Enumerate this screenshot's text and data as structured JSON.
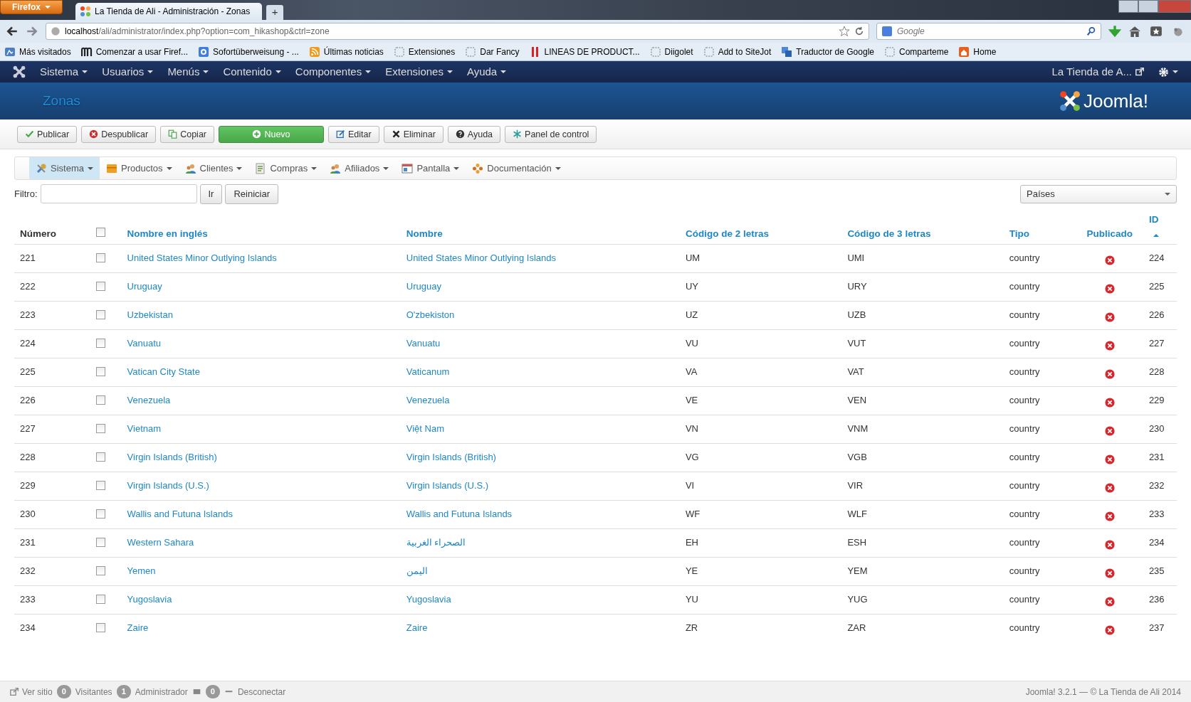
{
  "browser": {
    "app_button": "Firefox",
    "tab_title": "La Tienda de Ali - Administración - Zonas",
    "new_tab": "+",
    "url_host": "localhost",
    "url_path": "/ali/administrator/index.php?option=com_hikashop&ctrl=zone",
    "search_placeholder": "Google",
    "bookmarks": [
      "Más visitados",
      "Comenzar a usar Firef...",
      "Sofortüberweisung - ...",
      "Últimas noticias",
      "Extensiones",
      "Dar Fancy",
      "LINEAS DE PRODUCT...",
      "Diigolet",
      "Add to SiteJot",
      "Traductor de Google",
      "Comparteme",
      "Home"
    ]
  },
  "admin_menu": {
    "items": [
      "Sistema",
      "Usuarios",
      "Menús",
      "Contenido",
      "Componentes",
      "Extensiones",
      "Ayuda"
    ],
    "site_link": "La Tienda de A..."
  },
  "page_title": "Zonas",
  "logo_text": "Joomla!",
  "toolbar": [
    {
      "label": "Publicar",
      "kind": "default"
    },
    {
      "label": "Despublicar",
      "kind": "default"
    },
    {
      "label": "Copiar",
      "kind": "default"
    },
    {
      "label": "Nuevo",
      "kind": "success"
    },
    {
      "label": "Editar",
      "kind": "default"
    },
    {
      "label": "Eliminar",
      "kind": "default"
    },
    {
      "label": "Ayuda",
      "kind": "default"
    },
    {
      "label": "Panel de control",
      "kind": "default"
    }
  ],
  "submenu": [
    {
      "label": "Sistema",
      "selected": true
    },
    {
      "label": "Productos",
      "selected": false
    },
    {
      "label": "Clientes",
      "selected": false
    },
    {
      "label": "Compras",
      "selected": false
    },
    {
      "label": "Afiliados",
      "selected": false
    },
    {
      "label": "Pantalla",
      "selected": false
    },
    {
      "label": "Documentación",
      "selected": false
    }
  ],
  "filter": {
    "label": "Filtro:",
    "go": "Ir",
    "reset": "Reiniciar",
    "select_value": "Países"
  },
  "table": {
    "columns": [
      {
        "label": "Número",
        "kind": "text"
      },
      {
        "kind": "checkbox",
        "checked": false
      },
      {
        "label": "Nombre en inglés",
        "kind": "link"
      },
      {
        "label": "Nombre",
        "kind": "link"
      },
      {
        "label": "Código de 2 letras",
        "kind": "link"
      },
      {
        "label": "Código de 3 letras",
        "kind": "link"
      },
      {
        "label": "Tipo",
        "kind": "link"
      },
      {
        "label": "Publicado",
        "kind": "link"
      },
      {
        "label": "ID",
        "kind": "link",
        "sorted": true
      }
    ],
    "rows": [
      {
        "num": "221",
        "checked": false,
        "name_en": "United States Minor Outlying Islands",
        "name": "United States Minor Outlying Islands",
        "code2": "UM",
        "code3": "UMI",
        "type": "country",
        "published": false,
        "id": "224"
      },
      {
        "num": "222",
        "checked": false,
        "name_en": "Uruguay",
        "name": "Uruguay",
        "code2": "UY",
        "code3": "URY",
        "type": "country",
        "published": false,
        "id": "225"
      },
      {
        "num": "223",
        "checked": false,
        "name_en": "Uzbekistan",
        "name": "O'zbekiston",
        "code2": "UZ",
        "code3": "UZB",
        "type": "country",
        "published": false,
        "id": "226"
      },
      {
        "num": "224",
        "checked": false,
        "name_en": "Vanuatu",
        "name": "Vanuatu",
        "code2": "VU",
        "code3": "VUT",
        "type": "country",
        "published": false,
        "id": "227"
      },
      {
        "num": "225",
        "checked": false,
        "name_en": "Vatican City State",
        "name": "Vaticanum",
        "code2": "VA",
        "code3": "VAT",
        "type": "country",
        "published": false,
        "id": "228"
      },
      {
        "num": "226",
        "checked": false,
        "name_en": "Venezuela",
        "name": "Venezuela",
        "code2": "VE",
        "code3": "VEN",
        "type": "country",
        "published": false,
        "id": "229"
      },
      {
        "num": "227",
        "checked": false,
        "name_en": "Vietnam",
        "name": "Việt Nam",
        "code2": "VN",
        "code3": "VNM",
        "type": "country",
        "published": false,
        "id": "230"
      },
      {
        "num": "228",
        "checked": false,
        "name_en": "Virgin Islands (British)",
        "name": "Virgin Islands (British)",
        "code2": "VG",
        "code3": "VGB",
        "type": "country",
        "published": false,
        "id": "231"
      },
      {
        "num": "229",
        "checked": false,
        "name_en": "Virgin Islands (U.S.)",
        "name": "Virgin Islands (U.S.)",
        "code2": "VI",
        "code3": "VIR",
        "type": "country",
        "published": false,
        "id": "232"
      },
      {
        "num": "230",
        "checked": false,
        "name_en": "Wallis and Futuna Islands",
        "name": "Wallis and Futuna Islands",
        "code2": "WF",
        "code3": "WLF",
        "type": "country",
        "published": false,
        "id": "233"
      },
      {
        "num": "231",
        "checked": false,
        "name_en": "Western Sahara",
        "name": "الصحراء الغربية",
        "code2": "EH",
        "code3": "ESH",
        "type": "country",
        "published": false,
        "id": "234"
      },
      {
        "num": "232",
        "checked": false,
        "name_en": "Yemen",
        "name": "اليمن",
        "code2": "YE",
        "code3": "YEM",
        "type": "country",
        "published": false,
        "id": "235"
      },
      {
        "num": "233",
        "checked": false,
        "name_en": "Yugoslavia",
        "name": "Yugoslavia",
        "code2": "YU",
        "code3": "YUG",
        "type": "country",
        "published": false,
        "id": "236"
      },
      {
        "num": "234",
        "checked": false,
        "name_en": "Zaire",
        "name": "Zaire",
        "code2": "ZR",
        "code3": "ZAR",
        "type": "country",
        "published": false,
        "id": "237"
      }
    ]
  },
  "footer": {
    "view_site": "Ver sitio",
    "visitors_count": "0",
    "visitors": "Visitantes",
    "admins_count": "1",
    "admins": "Administrador",
    "messages_count": "0",
    "logout": "Desconectar",
    "credits": "Joomla! 3.2.1 — © La Tienda de Ali 2014"
  }
}
